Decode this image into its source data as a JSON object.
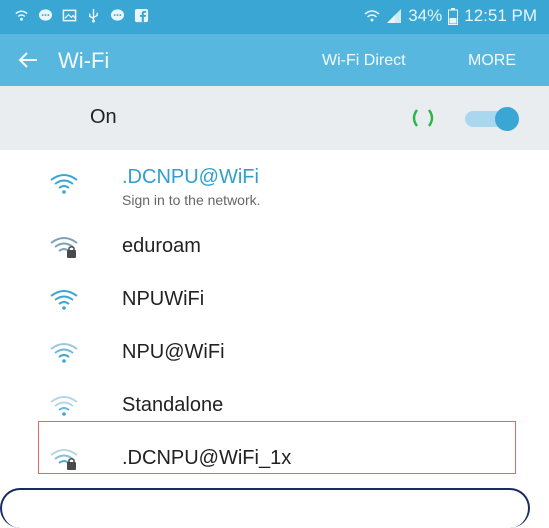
{
  "status_bar": {
    "battery": "34%",
    "time": "12:51 PM",
    "icons": [
      "wifi-calling-icon",
      "message-icon",
      "gallery-icon",
      "usb-icon",
      "message-icon",
      "facebook-icon",
      "signal-icon",
      "battery-icon"
    ]
  },
  "app_bar": {
    "title": "Wi-Fi",
    "wifi_direct_label": "Wi-Fi Direct",
    "more_label": "MORE"
  },
  "toggle": {
    "label": "On",
    "state": "on"
  },
  "networks": [
    {
      "name": ".DCNPU@WiFi",
      "subtitle": "Sign in to the network.",
      "secured": false,
      "connected": true
    },
    {
      "name": "eduroam",
      "secured": true
    },
    {
      "name": "NPUWiFi",
      "secured": false
    },
    {
      "name": "NPU@WiFi",
      "secured": false
    },
    {
      "name": "Standalone",
      "secured": false
    },
    {
      "name": ".DCNPU@WiFi_1x",
      "secured": true,
      "highlighted": true
    }
  ],
  "colors": {
    "status_bar": "#3aa6d4",
    "app_bar": "#58b7de",
    "toggle_row": "#e9edf0",
    "accent": "#2e9fd0",
    "highlight_border": "#e0676c",
    "callout_border": "#1b2a60"
  }
}
